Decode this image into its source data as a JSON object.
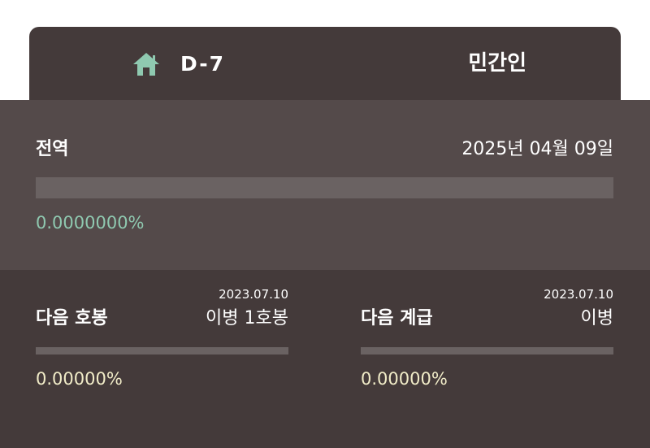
{
  "header": {
    "home_icon": "home-icon",
    "dday": "D-7",
    "status": "민간인"
  },
  "total": {
    "label": "전역",
    "date": "2025년 04월 09일",
    "progress_fraction": 0,
    "percent_text": "0.0000000%"
  },
  "next_step": {
    "label": "다음 호봉",
    "date": "2023.07.10",
    "value": "이병 1호봉",
    "progress_fraction": 0,
    "percent_text": "0.00000%"
  },
  "next_rank": {
    "label": "다음 계급",
    "date": "2023.07.10",
    "value": "이병",
    "progress_fraction": 0,
    "percent_text": "0.00000%"
  },
  "colors": {
    "header_bg": "#443a3a",
    "section_bg": "#544a4a",
    "accent_green": "#8fc9b0",
    "accent_cream": "#f1ecc8"
  }
}
